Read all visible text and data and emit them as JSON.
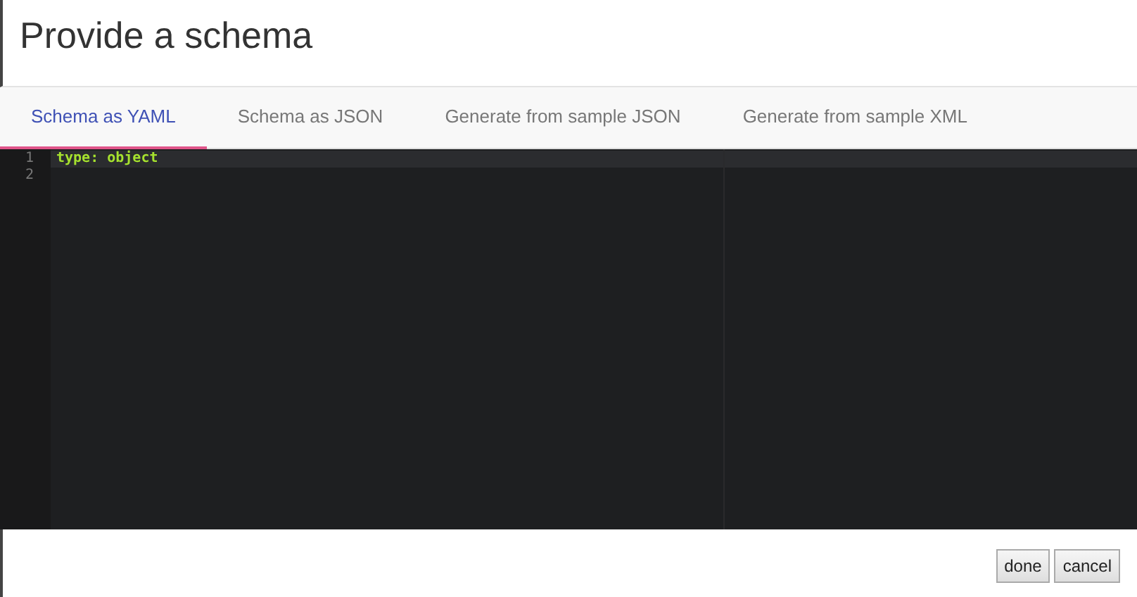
{
  "dialog": {
    "title": "Provide a schema"
  },
  "tabs": [
    {
      "label": "Schema as YAML",
      "selected": true
    },
    {
      "label": "Schema as JSON",
      "selected": false
    },
    {
      "label": "Generate from sample JSON",
      "selected": false
    },
    {
      "label": "Generate from sample XML",
      "selected": false
    }
  ],
  "editor": {
    "lines": [
      {
        "number": "1",
        "text": "type: object",
        "active": true
      },
      {
        "number": "2",
        "active": false
      }
    ]
  },
  "buttons": [
    "done",
    "cancel"
  ]
}
